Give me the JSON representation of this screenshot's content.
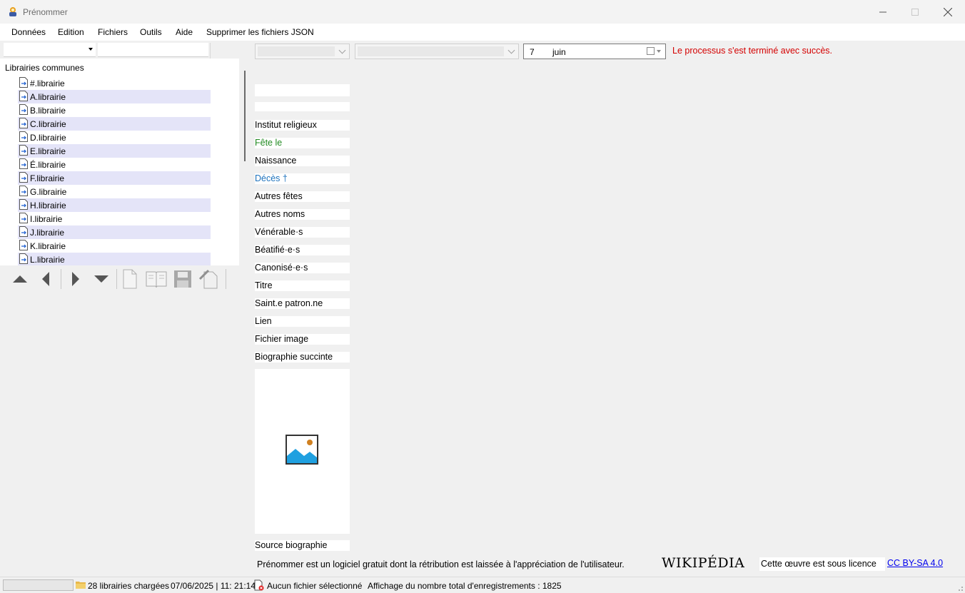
{
  "window": {
    "title": "Prénommer"
  },
  "menu": [
    {
      "label": "Données"
    },
    {
      "label": "Edition"
    },
    {
      "label": "Fichiers"
    },
    {
      "label": "Outils"
    },
    {
      "label": "Aide"
    },
    {
      "label": "Supprimer les fichiers JSON"
    }
  ],
  "tree": {
    "root": "Librairies communes",
    "items": [
      {
        "label": "#.librairie"
      },
      {
        "label": "A.librairie"
      },
      {
        "label": "B.librairie"
      },
      {
        "label": "C.librairie"
      },
      {
        "label": "D.librairie"
      },
      {
        "label": "E.librairie"
      },
      {
        "label": "É.librairie"
      },
      {
        "label": "F.librairie"
      },
      {
        "label": "G.librairie"
      },
      {
        "label": "H.librairie"
      },
      {
        "label": "I.librairie"
      },
      {
        "label": "J.librairie"
      },
      {
        "label": "K.librairie"
      },
      {
        "label": "L.librairie"
      }
    ],
    "highlight_color": "#e4e4f8"
  },
  "toolbar": {
    "buttons": [
      {
        "icon": "arrow-up-icon"
      },
      {
        "icon": "arrow-left-icon"
      },
      {
        "icon": "arrow-right-icon"
      },
      {
        "icon": "arrow-down-icon"
      },
      {
        "icon": "new-file-icon"
      },
      {
        "icon": "open-book-icon"
      },
      {
        "icon": "save-icon"
      },
      {
        "icon": "edit-file-icon"
      }
    ]
  },
  "date": {
    "day": "7",
    "month": "juin"
  },
  "status_message": "Le processus s'est terminé avec succès.",
  "status_color": "#d40000",
  "fields": [
    {
      "label": "Institut religieux",
      "color": "#000000"
    },
    {
      "label": "Fête le",
      "color": "#228b22"
    },
    {
      "label": "Naissance",
      "color": "#000000"
    },
    {
      "label": "Décès †",
      "color": "#1e73be"
    },
    {
      "label": "Autres fêtes",
      "color": "#000000"
    },
    {
      "label": "Autres noms",
      "color": "#000000"
    },
    {
      "label": "Vénérable·s",
      "color": "#000000"
    },
    {
      "label": "Béatifié·e·s",
      "color": "#000000"
    },
    {
      "label": "Canonisé·e·s",
      "color": "#000000"
    },
    {
      "label": "Titre",
      "color": "#000000"
    },
    {
      "label": "Saint.e patron.ne",
      "color": "#000000"
    },
    {
      "label": "Lien",
      "color": "#000000"
    },
    {
      "label": "Fichier image",
      "color": "#000000"
    },
    {
      "label": "Biographie succinte",
      "color": "#000000"
    }
  ],
  "source_label": "Source biographie",
  "footer": {
    "text": "Prénommer est un logiciel gratuit dont la rétribution est laissée à l'appréciation de l'utilisateur.",
    "wiki_logo": "WIKIPÉDIA",
    "license_text": "Cette œuvre est sous licence",
    "license_link": "CC BY-SA 4.0"
  },
  "statusbar": {
    "libraries": "28 librairies chargées",
    "datetime": "07/06/2025 | 11: 21:14",
    "file": "Aucun fichier sélectionné",
    "records": "Affichage du nombre total d'enregistrements : 1825"
  }
}
